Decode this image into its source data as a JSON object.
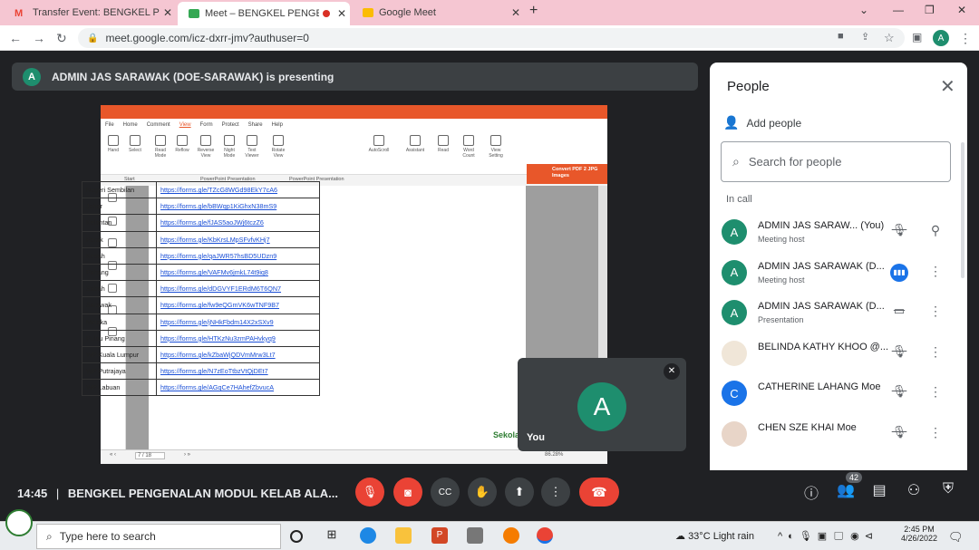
{
  "tabs": [
    {
      "title": "Transfer Event: BENGKEL PENGEN"
    },
    {
      "title": "Meet – BENGKEL PENGENAL"
    },
    {
      "title": "Google Meet"
    }
  ],
  "address": {
    "url": "meet.google.com/icz-dxrr-jmv?authuser=0",
    "profile_initial": "A"
  },
  "banner": {
    "avatar": "A",
    "text": "ADMIN JAS SARAWAK (DOE-SARAWAK) is presenting"
  },
  "pdf": {
    "menu": [
      "File",
      "Home",
      "Comment",
      "View",
      "Form",
      "Protect",
      "Share",
      "Help"
    ],
    "ribbon": [
      "Hand",
      "Select",
      "Read Mode",
      "Reflow",
      "Reverse View",
      "Night Mode",
      "Text Viewer",
      "Rotate View",
      "AutoScroll",
      "Assistant",
      "Read",
      "Word Count",
      "View Setting"
    ],
    "doc_tabs": [
      "Start",
      "PowerPoint Presentation",
      "PowerPoint Presentation"
    ],
    "convert_label": "Convert PDF 2 JPG Images",
    "page_indicator": "7 / 18",
    "zoom": "86.28%",
    "rows": [
      {
        "state": "Negeri Sembilan",
        "link": "https://forms.gle/TZcG8WGd98EkY7cA6"
      },
      {
        "state": "Johor",
        "link": "https://forms.gle/bBWqp1KiGhxN38mS9"
      },
      {
        "state": "Kelantan",
        "link": "https://forms.gle/fJAS5aoJWj6tczZ6"
      },
      {
        "state": "Perak",
        "link": "https://forms.gle/KbKrsLMpSFvfvKHj7"
      },
      {
        "state": "Kedah",
        "link": "https://forms.gle/qaJWR57hsBD5UDzn9"
      },
      {
        "state": "Pahang",
        "link": "https://forms.gle/VAFMv6jmkL74t9iq8"
      },
      {
        "state": "Sabah",
        "link": "https://forms.gle/dDGVYF1ERdM6T6QN7"
      },
      {
        "state": "Sarawak",
        "link": "https://forms.gle/fw9eQGmVK6wTNF9B7"
      },
      {
        "state": "Melaka",
        "link": "https://forms.gle/jNHkFbdm14X2xSXv9"
      },
      {
        "state": "Pulau Pinang",
        "link": "https://forms.gle/HTKzNu3zmPAHvkyq9"
      },
      {
        "state": "WP Kuala Lumpur",
        "link": "https://forms.gle/kZbaWjQDVmMrw3Lt7"
      },
      {
        "state": "WP Putrajaya",
        "link": "https://forms.gle/N7zEoTtbzVtQjDEt7"
      },
      {
        "state": "WP Labuan",
        "link": "https://forms.gle/AGqCe7HAhefZbvucA"
      }
    ],
    "watermark": "Sekolah"
  },
  "self_tile": {
    "avatar": "A",
    "label": "You"
  },
  "people": {
    "title": "People",
    "add_label": "Add people",
    "search_placeholder": "Search for people",
    "in_call_label": "In call",
    "participants": [
      {
        "initial": "A",
        "name": "ADMIN JAS SARAW... (You)",
        "role": "Meeting host",
        "color": "#1e8e6e"
      },
      {
        "initial": "A",
        "name": "ADMIN JAS SARAWAK (D...",
        "role": "Meeting host",
        "color": "#1e8e6e"
      },
      {
        "initial": "A",
        "name": "ADMIN JAS SARAWAK (D...",
        "role": "Presentation",
        "color": "#1e8e6e"
      },
      {
        "initial": "",
        "name": "BELINDA KATHY KHOO @...",
        "role": "",
        "color": "#f0e6d8"
      },
      {
        "initial": "C",
        "name": "CATHERINE LAHANG Moe",
        "role": "",
        "color": "#1a73e8"
      },
      {
        "initial": "",
        "name": "CHEN SZE KHAI Moe",
        "role": "",
        "color": "#e8d5c8"
      }
    ]
  },
  "bottom": {
    "time": "14:45",
    "meeting_title": "BENGKEL PENGENALAN MODUL KELAB ALA...",
    "people_count": "42"
  },
  "taskbar": {
    "search_placeholder": "Type here to search",
    "weather": "33°C  Light rain",
    "time": "2:45 PM",
    "date": "4/26/2022"
  },
  "colors": {
    "accent_red": "#ea4335",
    "meet_bg": "#202124",
    "avatar_green": "#1e8e6e",
    "tabbar_pink": "#f5c6d2"
  }
}
